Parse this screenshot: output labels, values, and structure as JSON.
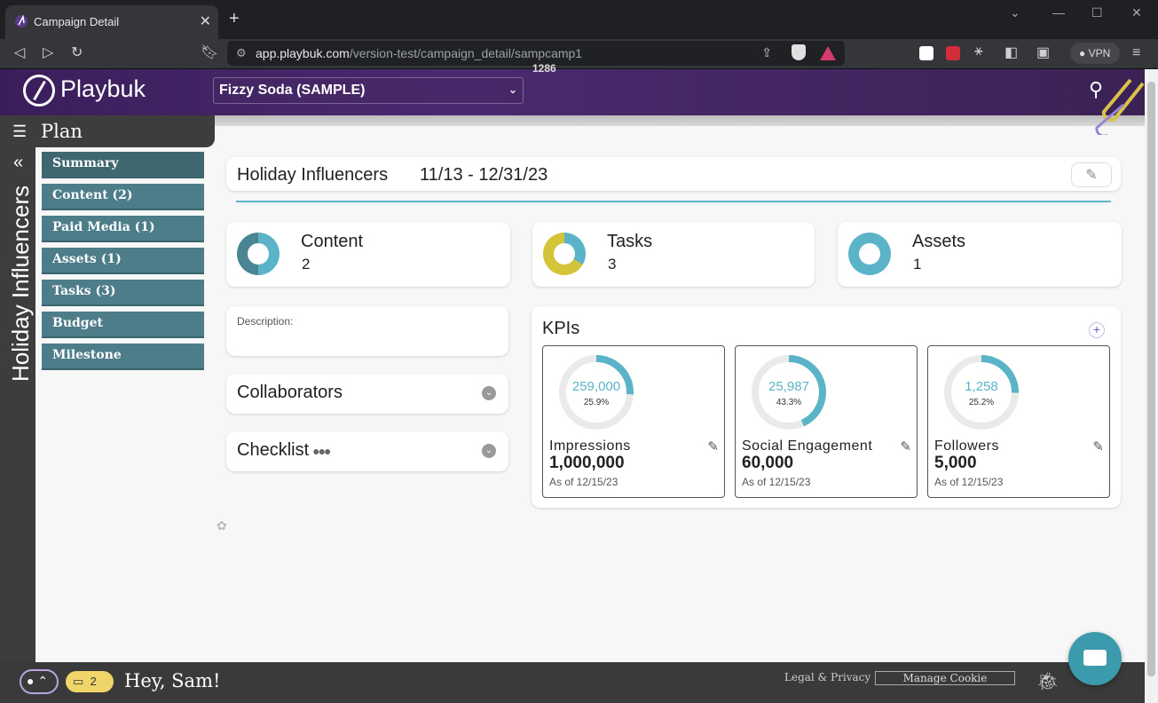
{
  "browser": {
    "tab_title": "Campaign Detail",
    "url_host": "app.playbuk.com",
    "url_path": "/version-test/campaign_detail/sampcamp1",
    "vpn_label": "VPN"
  },
  "header": {
    "logo_text": "Playbuk",
    "campaign_select": "Fizzy Soda (SAMPLE)",
    "top_number": "1286"
  },
  "sidebar": {
    "plan_label": "Plan",
    "vertical_title": "Holiday Influencers",
    "items": [
      {
        "label": "Summary"
      },
      {
        "label": "Content (2)"
      },
      {
        "label": "Paid Media (1)"
      },
      {
        "label": "Assets (1)"
      },
      {
        "label": "Tasks (3)"
      },
      {
        "label": "Budget"
      },
      {
        "label": "Milestone"
      }
    ]
  },
  "campaign": {
    "name": "Holiday Influencers",
    "dates": "11/13 - 12/31/23"
  },
  "stats": {
    "content": {
      "label": "Content",
      "value": "2"
    },
    "tasks": {
      "label": "Tasks",
      "value": "3"
    },
    "assets": {
      "label": "Assets",
      "value": "1"
    }
  },
  "description_label": "Description:",
  "collaborators_label": "Collaborators",
  "checklist_label": "Checklist",
  "kpis": {
    "title": "KPIs",
    "items": [
      {
        "name": "Impressions",
        "value": "259,000",
        "percent": "25.9%",
        "progress": 0.259,
        "goal": "1,000,000",
        "as_of": "As of 12/15/23"
      },
      {
        "name": "Social Engagement",
        "value": "25,987",
        "percent": "43.3%",
        "progress": 0.433,
        "goal": "60,000",
        "as_of": "As of 12/15/23"
      },
      {
        "name": "Followers",
        "value": "1,258",
        "percent": "25.2%",
        "progress": 0.252,
        "goal": "5,000",
        "as_of": "As of 12/15/23"
      }
    ]
  },
  "footer": {
    "inbox_count": "2",
    "greeting": "Hey, Sam!",
    "legal": "Legal & Privacy",
    "cookie": "Manage Cookie"
  },
  "colors": {
    "teal": "#5bb3c8",
    "menu_teal": "#4d7d89",
    "purple": "#3a1e5a",
    "yellow": "#d4c43a"
  }
}
